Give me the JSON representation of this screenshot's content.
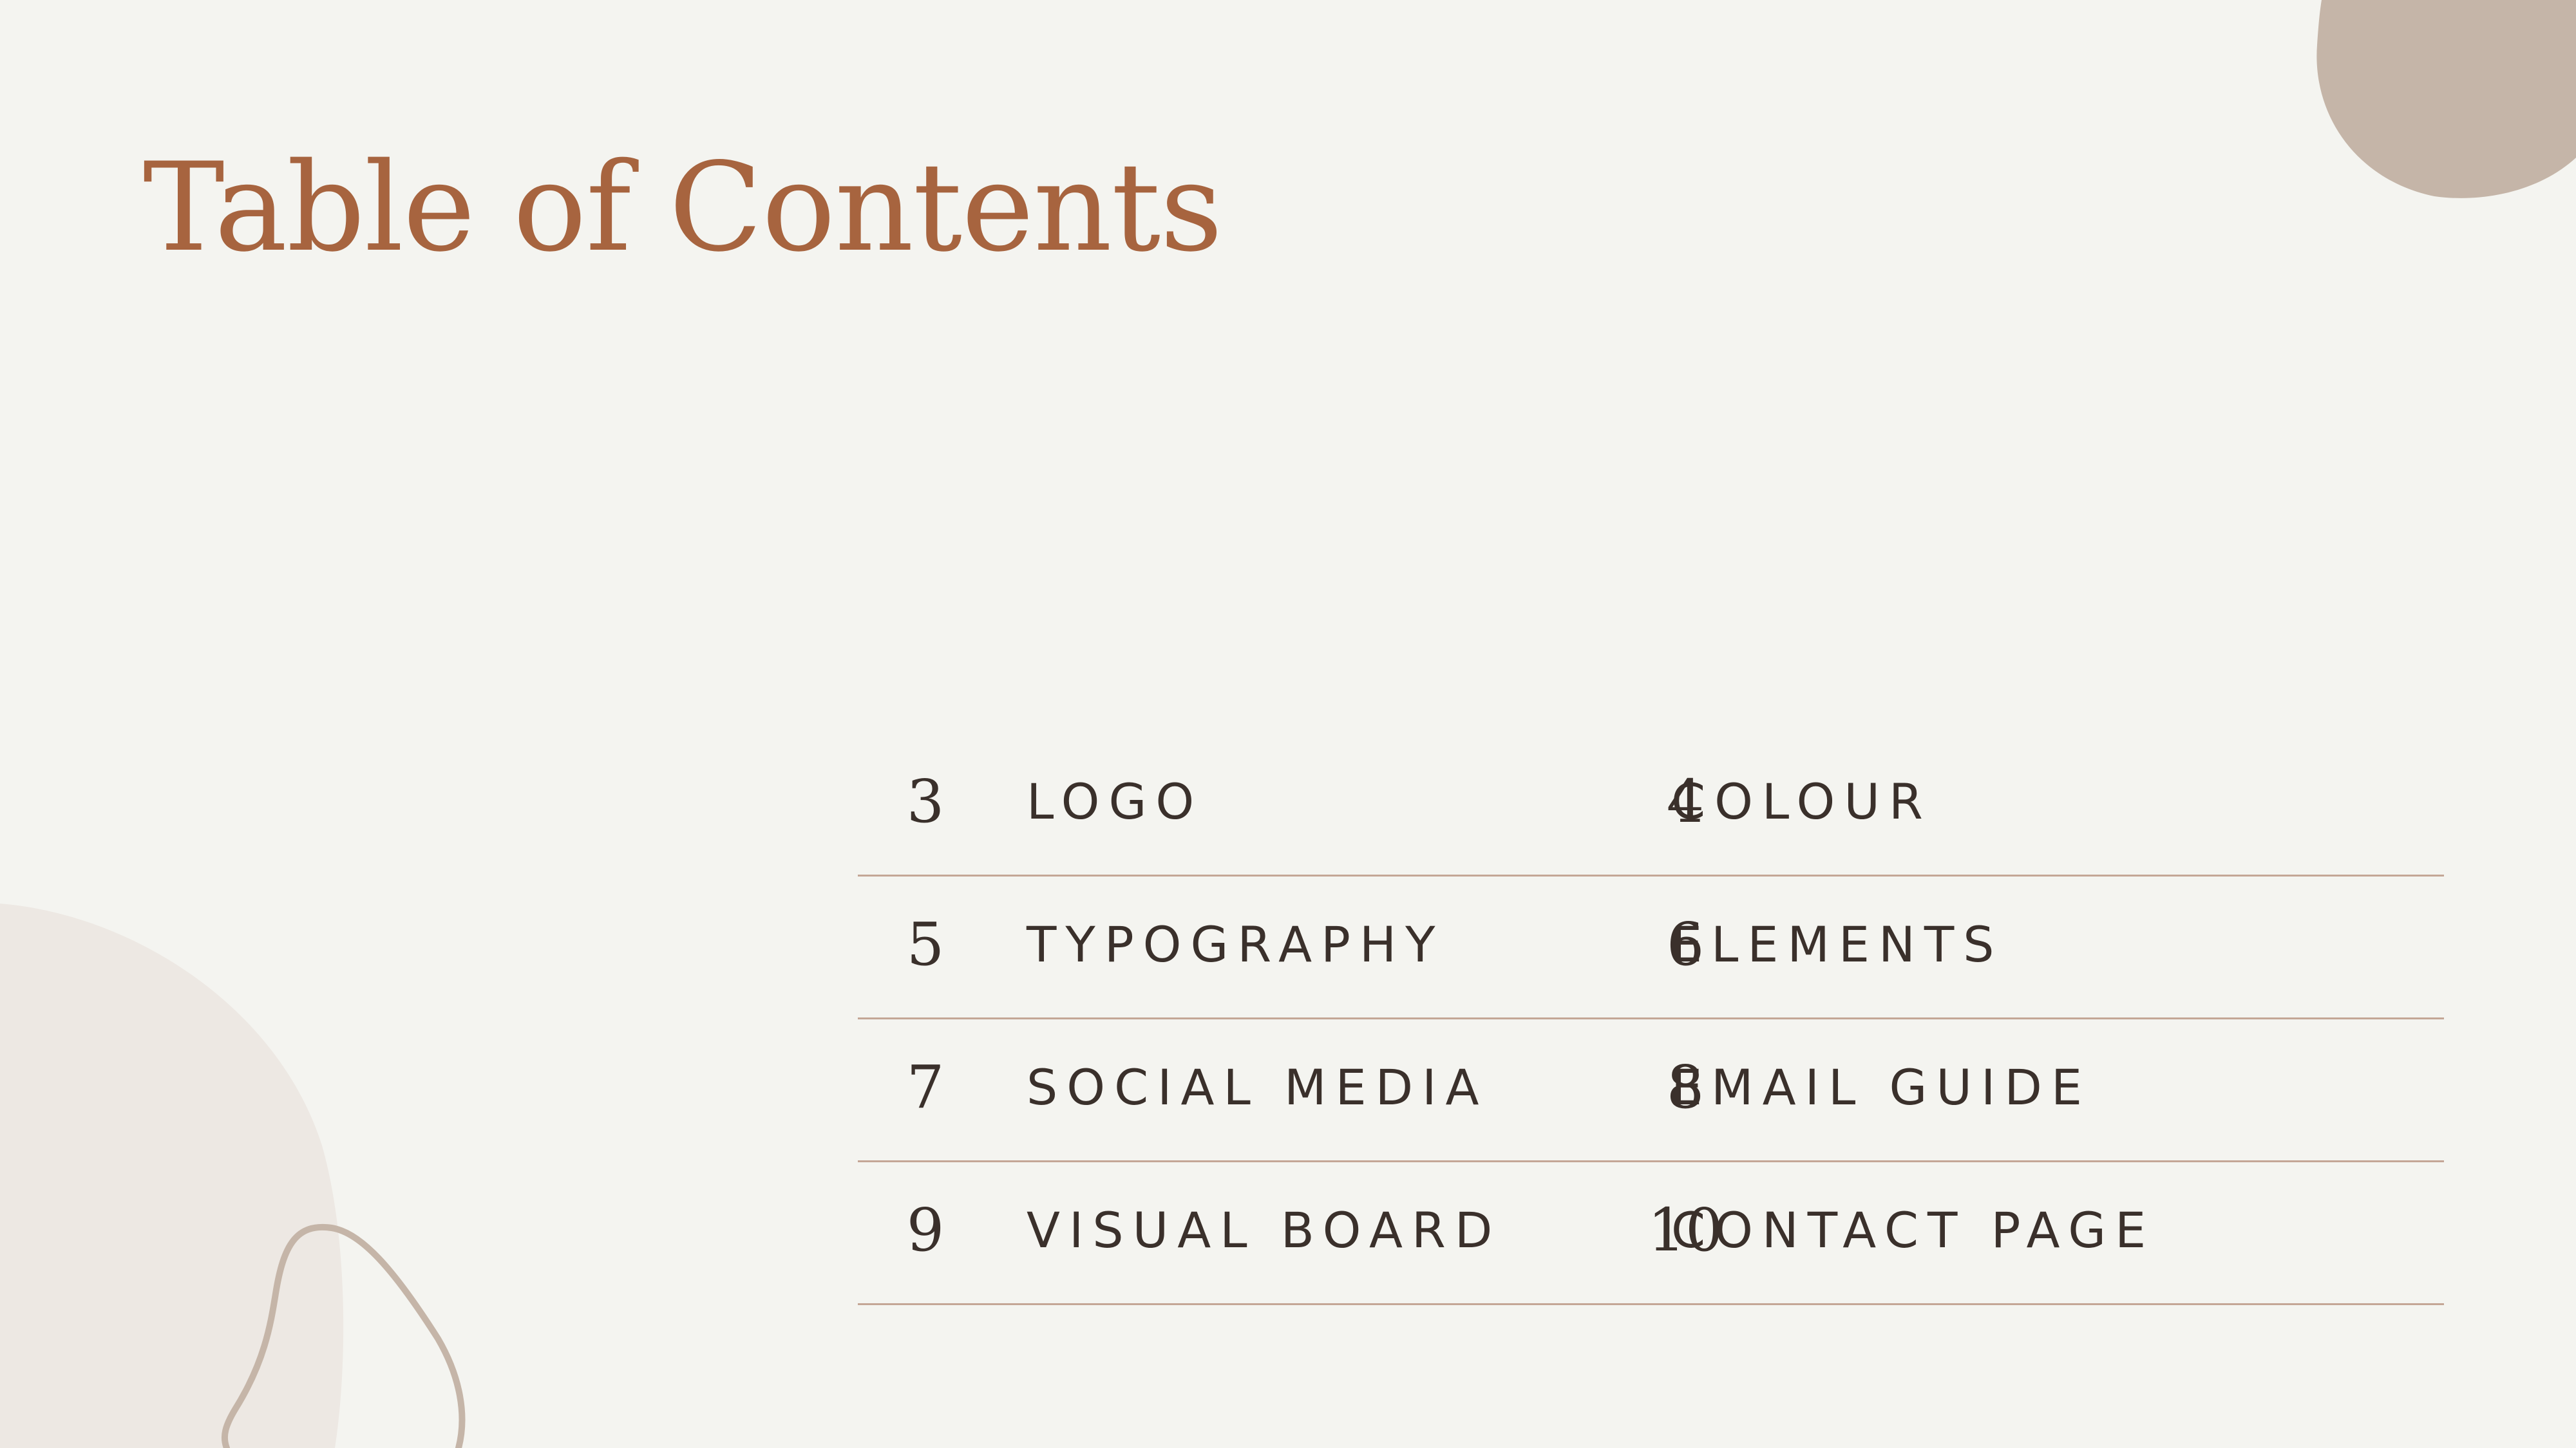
{
  "title": "Table of Contents",
  "colors": {
    "background": "#f4f4f0",
    "title": "#a7643f",
    "text": "#3a302b",
    "divider": "#c4a696",
    "blob_top_right": "#c5b5a8",
    "blob_bottom_left": "#ede8e3",
    "loop_outline": "#c5b5a8"
  },
  "toc": {
    "rows": [
      {
        "left": {
          "number": "3",
          "label": "LOGO"
        },
        "right": {
          "number": "4",
          "label": "COLOUR"
        }
      },
      {
        "left": {
          "number": "5",
          "label": "TYPOGRAPHY"
        },
        "right": {
          "number": "6",
          "label": "ELEMENTS"
        }
      },
      {
        "left": {
          "number": "7",
          "label": "SOCIAL MEDIA"
        },
        "right": {
          "number": "8",
          "label": "EMAIL GUIDE"
        }
      },
      {
        "left": {
          "number": "9",
          "label": "VISUAL BOARD"
        },
        "right": {
          "number": "10",
          "label": "CONTACT PAGE"
        }
      }
    ]
  }
}
